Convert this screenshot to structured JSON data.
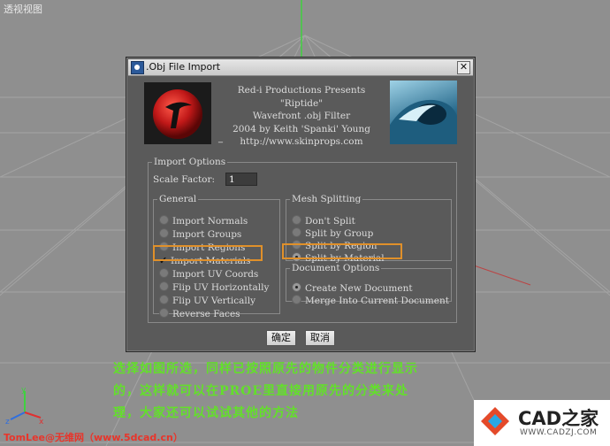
{
  "viewport": {
    "label": "透视视图"
  },
  "dialog": {
    "title": ".Obj File Import",
    "close": "✕",
    "credits": [
      "Red-i Productions Presents",
      "\"Riptide\"",
      "Wavefront .obj Filter",
      "2004 by Keith 'Spanki' Young",
      "http://www.skinprops.com"
    ],
    "dash": "_",
    "import_options": {
      "legend": "Import Options",
      "scale_label": "Scale Factor:",
      "scale_value": "1"
    },
    "general": {
      "legend": "General",
      "items": [
        {
          "label": "Import Normals",
          "checked": false
        },
        {
          "label": "Import Groups",
          "checked": false
        },
        {
          "label": "Import Regions",
          "checked": false
        },
        {
          "label": "Import Materials",
          "checked": true
        },
        {
          "label": "Import UV Coords",
          "checked": false
        },
        {
          "label": "Flip UV Horizontally",
          "checked": false
        },
        {
          "label": "Flip UV Vertically",
          "checked": false
        },
        {
          "label": "Reverse Faces",
          "checked": false
        }
      ]
    },
    "mesh_splitting": {
      "legend": "Mesh Splitting",
      "items": [
        {
          "label": "Don't Split",
          "selected": false
        },
        {
          "label": "Split by Group",
          "selected": false
        },
        {
          "label": "Split by Region",
          "selected": false
        },
        {
          "label": "Split by Material",
          "selected": true
        }
      ]
    },
    "document_options": {
      "legend": "Document Options",
      "items": [
        {
          "label": "Create New Document",
          "selected": true
        },
        {
          "label": "Merge Into Current Document",
          "selected": false
        }
      ]
    },
    "buttons": {
      "ok": "确定",
      "cancel": "取消"
    }
  },
  "caption": {
    "lines": [
      "选择如图所选，同样已按照原先的物件分类进行显示",
      "的，这样就可以在PROE里直接用原先的分类来处",
      "理，大家还可以试试其他的方法"
    ]
  },
  "footer": {
    "credit": "TomLee@无维网（www.5dcad.cn）",
    "brand_name": "CAD之家",
    "brand_url": "WWW.CADZJ.COM",
    "axis_x": "x",
    "axis_y": "y",
    "axis_z": "z"
  },
  "colors": {
    "caption": "#63e02a",
    "highlight": "#e0902a",
    "credit": "#e8352b"
  }
}
